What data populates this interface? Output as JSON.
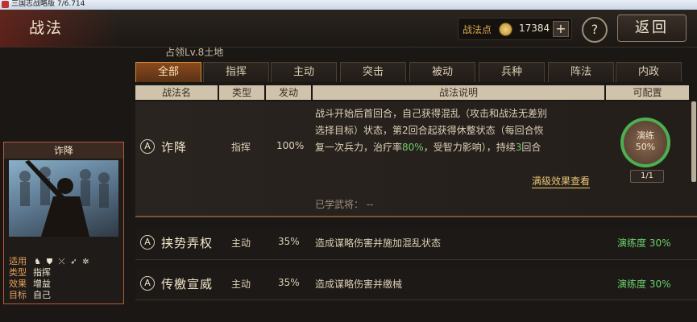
{
  "window": {
    "title": "三国志战略版 7/6.714"
  },
  "header": {
    "title": "战法",
    "points_label": "战法点",
    "points_value": "17384",
    "add_label": "+",
    "help_label": "?",
    "back_label": "返回"
  },
  "subtitle": "占领Lv.8土地",
  "tabs": [
    {
      "label": "全部"
    },
    {
      "label": "指挥"
    },
    {
      "label": "主动"
    },
    {
      "label": "突击"
    },
    {
      "label": "被动"
    },
    {
      "label": "兵种"
    },
    {
      "label": "阵法"
    },
    {
      "label": "内政"
    }
  ],
  "columns": [
    "战法名",
    "类型",
    "发动",
    "战法说明",
    "可配置"
  ],
  "selected_skill": {
    "grade": "A",
    "name": "诈降",
    "type": "指挥",
    "rate": "100%",
    "desc_1": "战斗开始后首回合，自己获得混乱（攻击和战法无差别",
    "desc_2": "选择目标）状态，第2回合起获得休整状态（每回合恢",
    "desc_3a": "复一次兵力，治疗率",
    "desc_3b": "80%",
    "desc_3c": "，受智力影响），持续",
    "desc_3d": "3",
    "desc_3e": "回合",
    "detail_link": "满级效果查看",
    "learned_label": "已学武将：  --",
    "practice_label": "演练",
    "practice_value": "50%",
    "slots": "1/1"
  },
  "skills": [
    {
      "grade": "A",
      "name": "挟势弄权",
      "type": "主动",
      "rate": "35%",
      "desc": "造成谋略伤害并施加混乱状态",
      "mastery": "演练度 30%"
    },
    {
      "grade": "A",
      "name": "传檄宣威",
      "type": "主动",
      "rate": "35%",
      "desc": "造成谋略伤害并缴械",
      "mastery": "演练度 30%"
    }
  ],
  "card": {
    "name": "诈降",
    "rows": [
      {
        "k": "适用",
        "v": ""
      },
      {
        "k": "类型",
        "v": "指挥"
      },
      {
        "k": "效果",
        "v": "增益"
      },
      {
        "k": "目标",
        "v": "自己"
      }
    ],
    "troop_icons": [
      "horse-icon",
      "shield-icon",
      "crossbow-icon",
      "spear-icon",
      "wheel-icon"
    ]
  },
  "colors": {
    "accent": "#d08a3a",
    "green": "#6ad06a",
    "gold": "#e9c775"
  }
}
